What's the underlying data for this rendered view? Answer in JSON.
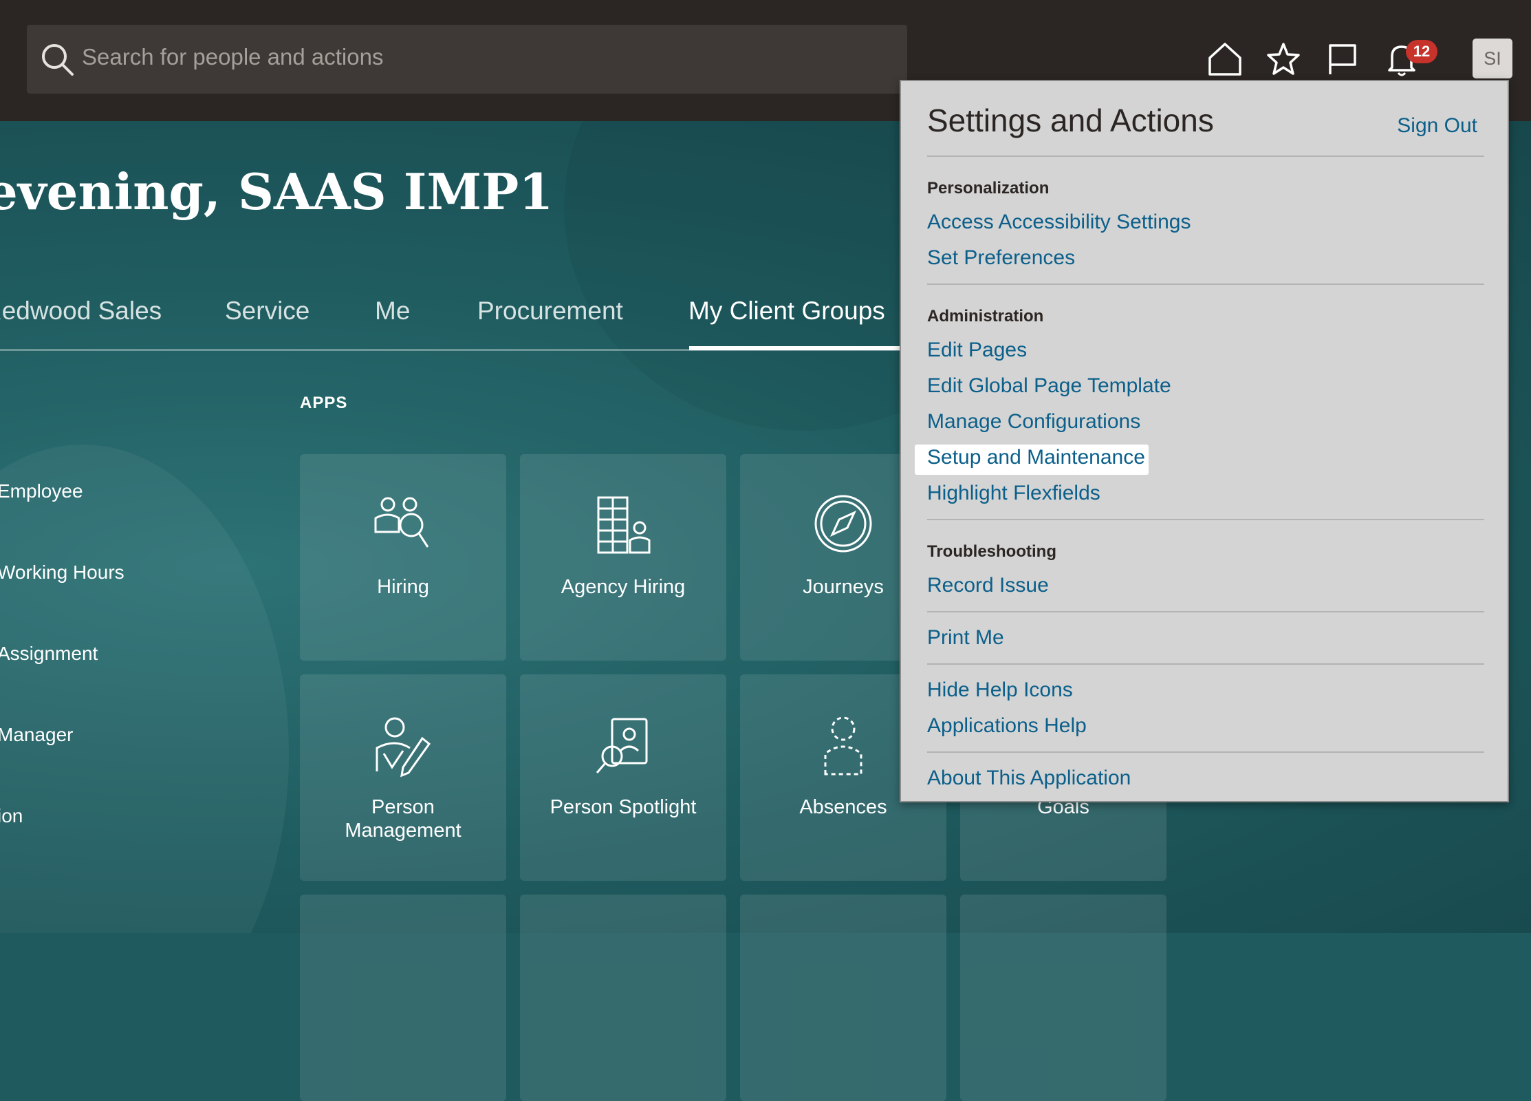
{
  "search": {
    "placeholder": "Search for people and actions"
  },
  "header": {
    "notification_count": "12",
    "avatar_initials": "SI"
  },
  "greeting": "evening, SAAS IMP1",
  "tabs": [
    {
      "label": "Redwood Sales"
    },
    {
      "label": "Service"
    },
    {
      "label": "Me"
    },
    {
      "label": "Procurement"
    },
    {
      "label": "My Client Groups",
      "active": true
    }
  ],
  "apps_label": "APPS",
  "quick_actions": [
    "Employee",
    "Working Hours",
    "Assignment",
    "Manager",
    "ion"
  ],
  "tiles": [
    {
      "label": "Hiring",
      "icon": "hiring-icon"
    },
    {
      "label": "Agency Hiring",
      "icon": "agency-hiring-icon"
    },
    {
      "label": "Journeys",
      "icon": "compass-icon"
    },
    {
      "label": "Person Management",
      "icon": "person-management-icon"
    },
    {
      "label": "Person Spotlight",
      "icon": "person-spotlight-icon"
    },
    {
      "label": "Absences",
      "icon": "absences-icon"
    },
    {
      "label": "Goals",
      "icon": "goals-icon"
    }
  ],
  "settings_menu": {
    "title": "Settings and Actions",
    "sign_out": "Sign Out",
    "sections": [
      {
        "heading": "Personalization",
        "items": [
          "Access Accessibility Settings",
          "Set Preferences"
        ]
      },
      {
        "heading": "Administration",
        "items": [
          "Edit Pages",
          "Edit Global Page Template",
          "Manage Configurations",
          "Setup and Maintenance",
          "Highlight Flexfields"
        ]
      },
      {
        "heading": "Troubleshooting",
        "items": [
          "Record Issue"
        ]
      },
      {
        "heading": "",
        "items": [
          "Print Me"
        ]
      },
      {
        "heading": "",
        "items": [
          "Hide Help Icons",
          "Applications Help"
        ]
      },
      {
        "heading": "",
        "items": [
          "About This Application"
        ]
      }
    ],
    "highlighted_item": "Setup and Maintenance"
  },
  "colors": {
    "link": "#0b5f8a",
    "topbar": "#2b2623",
    "background": "#1f5a5e",
    "badge": "#c7322b"
  }
}
